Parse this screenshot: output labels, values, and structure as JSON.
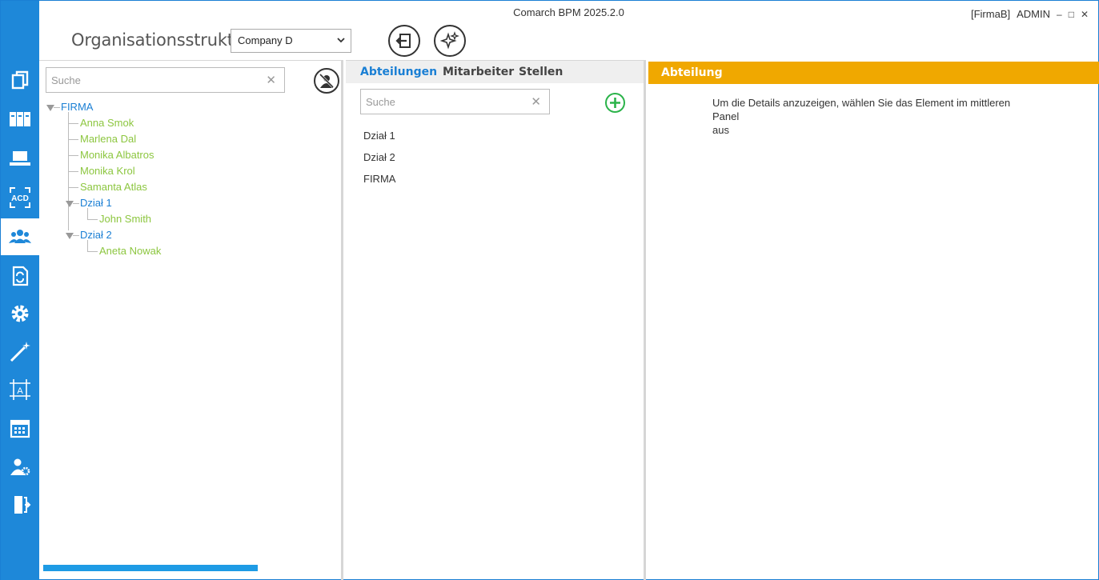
{
  "window": {
    "title": "Comarch BPM 2025.2.0",
    "company_tag": "[FirmaB]",
    "user": "ADMIN",
    "minimize": "‒",
    "maximize": "□",
    "close": "✕"
  },
  "sidebar": {
    "items": [
      {
        "icon": "documents-icon",
        "active": false
      },
      {
        "icon": "binders-icon",
        "active": false
      },
      {
        "icon": "laptop-icon",
        "active": false
      },
      {
        "icon": "acd-icon",
        "active": false,
        "label": "ACD"
      },
      {
        "icon": "users-group-icon",
        "active": true
      },
      {
        "icon": "document-sync-icon",
        "active": false
      },
      {
        "icon": "gear-icon",
        "active": false
      },
      {
        "icon": "magic-wand-icon",
        "active": false
      },
      {
        "icon": "text-frame-icon",
        "active": false,
        "label": "A"
      },
      {
        "icon": "calendar-icon",
        "active": false
      },
      {
        "icon": "user-settings-icon",
        "active": false
      },
      {
        "icon": "exit-door-icon",
        "active": false
      }
    ]
  },
  "header": {
    "title": "Organisationsstruktur",
    "company_value": "Company D"
  },
  "left_panel": {
    "search_placeholder": "Suche",
    "tree": {
      "root": "FIRMA",
      "employees": [
        "Anna Smok",
        "Marlena Dal",
        "Monika Albatros",
        "Monika Krol",
        "Samanta Atlas"
      ],
      "dept1": {
        "name": "Dział 1",
        "members": [
          "John Smith"
        ]
      },
      "dept2": {
        "name": "Dział 2",
        "members": [
          "Aneta Nowak"
        ]
      }
    }
  },
  "mid_panel": {
    "tabs": [
      "Abteilungen",
      "Mitarbeiter",
      "Stellen"
    ],
    "active_tab": "Abteilungen",
    "search_placeholder": "Suche",
    "items": [
      "Dział 1",
      "Dział 2",
      "FIRMA"
    ]
  },
  "right_panel": {
    "header": "Abteilung",
    "info_line1": "Um die Details anzuzeigen, wählen Sie das Element im mittleren Panel",
    "info_line2": "aus"
  },
  "colors": {
    "sidebar": "#1e88d9",
    "accent_blue": "#1a7fd4",
    "employee_green": "#8cc63f",
    "header_orange": "#f0a800",
    "add_green": "#2bb34a"
  }
}
